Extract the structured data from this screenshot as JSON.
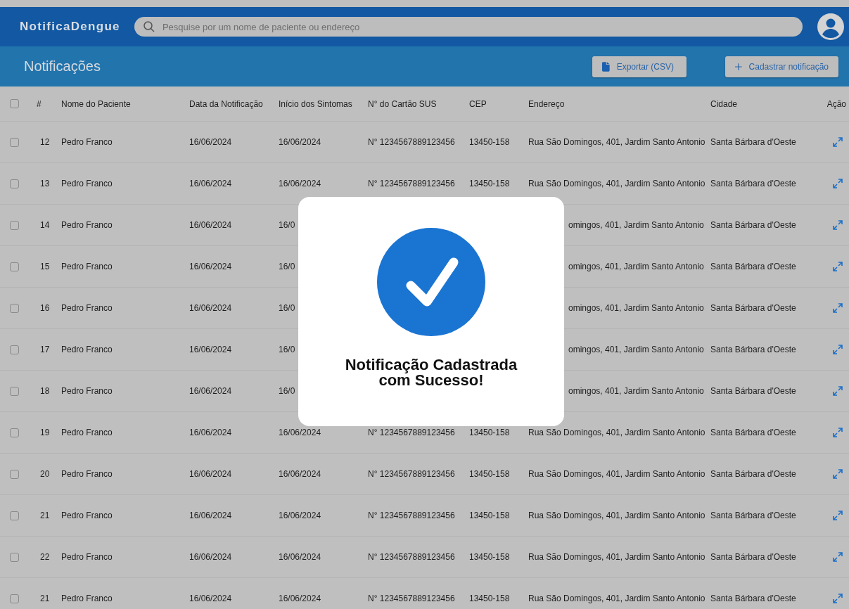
{
  "app": {
    "logo": "NotificaDengue",
    "search": {
      "placeholder": "Pesquise por um nome de paciente ou endereço"
    }
  },
  "page": {
    "title": "Notificações",
    "buttons": [
      {
        "kind": "export",
        "label": "Exportar (CSV)"
      },
      {
        "kind": "add",
        "label": "Cadastrar notificação"
      }
    ]
  },
  "table": {
    "select_all": {
      "checked": false
    },
    "columns": [
      "#",
      "Nome do Paciente",
      "Data da Notificação",
      "Início dos Sintomas",
      "N° do Cartão SUS",
      "CEP",
      "Endereço",
      "Cidade",
      "Ação"
    ],
    "rows": [
      {
        "checked": false,
        "cells": [
          "12",
          "Pedro Franco",
          "16/06/2024",
          "16/06/2024",
          "N° 1234567889123456",
          "13450-158",
          "Rua São Domingos, 401, Jardim Santo Antonio",
          "Santa Bárbara d'Oeste"
        ]
      },
      {
        "checked": false,
        "cells": [
          "13",
          "Pedro Franco",
          "16/06/2024",
          "16/06/2024",
          "N° 1234567889123456",
          "13450-158",
          "Rua São Domingos, 401, Jardim Santo Antonio",
          "Santa Bárbara d'Oeste"
        ]
      },
      {
        "checked": false,
        "cells": [
          "14",
          "Pedro Franco",
          "16/06/2024",
          "16/0",
          null,
          null,
          "omingos, 401, Jardim Santo Antonio",
          "Santa Bárbara d'Oeste"
        ]
      },
      {
        "checked": false,
        "cells": [
          "15",
          "Pedro Franco",
          "16/06/2024",
          "16/0",
          null,
          null,
          "omingos, 401, Jardim Santo Antonio",
          "Santa Bárbara d'Oeste"
        ]
      },
      {
        "checked": false,
        "cells": [
          "16",
          "Pedro Franco",
          "16/06/2024",
          "16/0",
          null,
          null,
          "omingos, 401, Jardim Santo Antonio",
          "Santa Bárbara d'Oeste"
        ]
      },
      {
        "checked": false,
        "cells": [
          "17",
          "Pedro Franco",
          "16/06/2024",
          "16/0",
          null,
          null,
          "omingos, 401, Jardim Santo Antonio",
          "Santa Bárbara d'Oeste"
        ]
      },
      {
        "checked": false,
        "cells": [
          "18",
          "Pedro Franco",
          "16/06/2024",
          "16/0",
          null,
          null,
          "omingos, 401, Jardim Santo Antonio",
          "Santa Bárbara d'Oeste"
        ]
      },
      {
        "checked": false,
        "cells": [
          "19",
          "Pedro Franco",
          "16/06/2024",
          "16/06/2024",
          "N° 1234567889123456",
          "13450-158",
          "Rua São Domingos, 401, Jardim Santo Antonio",
          "Santa Bárbara d'Oeste"
        ]
      },
      {
        "checked": false,
        "cells": [
          "20",
          "Pedro Franco",
          "16/06/2024",
          "16/06/2024",
          "N° 1234567889123456",
          "13450-158",
          "Rua São Domingos, 401, Jardim Santo Antonio",
          "Santa Bárbara d'Oeste"
        ]
      },
      {
        "checked": false,
        "cells": [
          "21",
          "Pedro Franco",
          "16/06/2024",
          "16/06/2024",
          "N° 1234567889123456",
          "13450-158",
          "Rua São Domingos, 401, Jardim Santo Antonio",
          "Santa Bárbara d'Oeste"
        ]
      },
      {
        "checked": false,
        "cells": [
          "22",
          "Pedro Franco",
          "16/06/2024",
          "16/06/2024",
          "N° 1234567889123456",
          "13450-158",
          "Rua São Domingos, 401, Jardim Santo Antonio",
          "Santa Bárbara d'Oeste"
        ]
      },
      {
        "checked": false,
        "cells": [
          "21",
          "Pedro Franco",
          "16/06/2024",
          "16/06/2024",
          "N° 1234567889123456",
          "13450-158",
          "Rua São Domingos, 401, Jardim Santo Antonio",
          "Santa Bárbara d'Oeste"
        ]
      }
    ]
  },
  "dialog": {
    "message": "Notificação Cadastrada com Sucesso!"
  }
}
